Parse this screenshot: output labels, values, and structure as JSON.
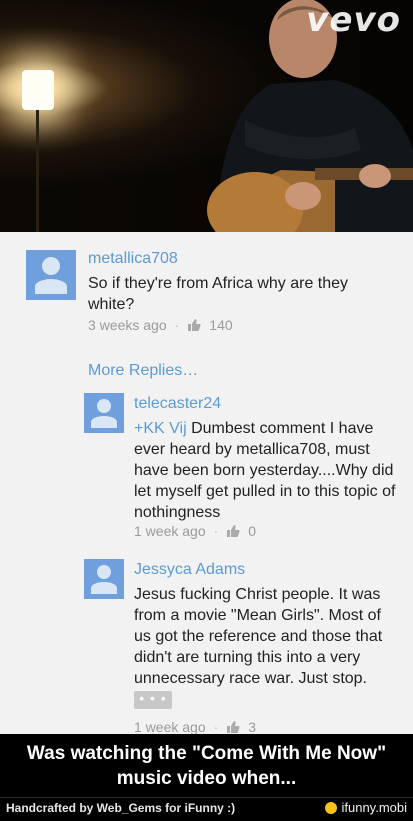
{
  "video": {
    "watermark": "vevo"
  },
  "comments": [
    {
      "author": "metallica708",
      "text": "So if they're from Africa why are they white?",
      "time": "3 weeks ago",
      "likes": "140"
    }
  ],
  "more_replies": "More Replies…",
  "replies": [
    {
      "author": "telecaster24",
      "mention": "+KK Vij",
      "text": " Dumbest comment I have ever heard by metallica708, must have been born yesterday....Why did let myself get pulled in to this topic of nothingness",
      "time": "1 week ago",
      "likes": "0"
    },
    {
      "author": "Jessyca Adams",
      "text": "Jesus fucking Christ people. It was from a movie \"Mean Girls\". Most of us got the reference and those that didn't are turning this into a very unnecessary race war. Just stop.",
      "expand": "• • •",
      "time": "1 week ago",
      "likes": "3"
    }
  ],
  "caption": {
    "line1": "Was watching the \"Come With Me Now\"",
    "line2": "music video when..."
  },
  "footer": {
    "credit": "Handcrafted by Web_Gems for iFunny :)",
    "brand": "ifunny.mobi"
  }
}
